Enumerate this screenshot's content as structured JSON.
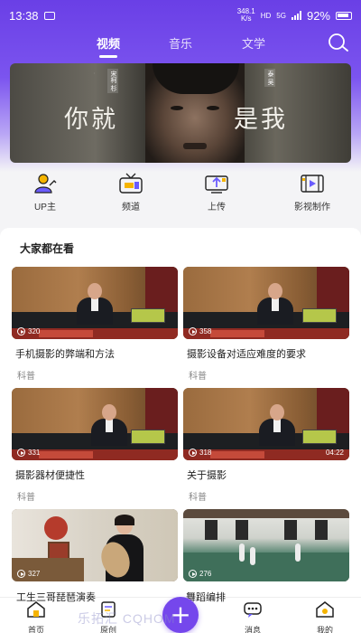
{
  "status_bar": {
    "time": "13:38",
    "speed_top": "348.1",
    "speed_bottom": "K/s",
    "net1": "HD",
    "net2": "5G",
    "battery": "92%"
  },
  "tabs": [
    {
      "label": "视频",
      "active": true
    },
    {
      "label": "音乐",
      "active": false
    },
    {
      "label": "文学",
      "active": false
    }
  ],
  "banner": {
    "text_left": "你就",
    "text_right": "是我",
    "name_left": "宋柯 杉",
    "name_right": "泰 吴"
  },
  "quick_menu": [
    {
      "label": "UP主",
      "icon": "user-upload-icon"
    },
    {
      "label": "频道",
      "icon": "tv-icon"
    },
    {
      "label": "上传",
      "icon": "upload-icon"
    },
    {
      "label": "影视制作",
      "icon": "film-icon"
    }
  ],
  "section": {
    "title": "大家都在看"
  },
  "videos": [
    {
      "title": "手机摄影的弊端和方法",
      "category": "科普",
      "plays": "320",
      "duration": ""
    },
    {
      "title": "摄影设备对适应难度的要求",
      "category": "科普",
      "plays": "358",
      "duration": ""
    },
    {
      "title": "摄影器材便捷性",
      "category": "科普",
      "plays": "331",
      "duration": ""
    },
    {
      "title": "关于摄影",
      "category": "科普",
      "plays": "318",
      "duration": "04:22"
    },
    {
      "title": "",
      "category": "",
      "plays": "327",
      "duration": ""
    },
    {
      "title": "",
      "category": "",
      "plays": "276",
      "duration": ""
    }
  ],
  "peek_titles": {
    "left": "工生三哥琵琶演奏",
    "right": "舞蹈编排"
  },
  "bottom_nav": [
    {
      "label": "首页",
      "icon": "home-icon"
    },
    {
      "label": "原创",
      "icon": "original-icon"
    },
    {
      "label": "消息",
      "icon": "message-icon"
    },
    {
      "label": "我的",
      "icon": "profile-icon"
    }
  ],
  "watermark": "乐拓汇 CQHOM",
  "colors": {
    "accent": "#7547ec",
    "header_gradient_top": "#6a3fe6"
  }
}
